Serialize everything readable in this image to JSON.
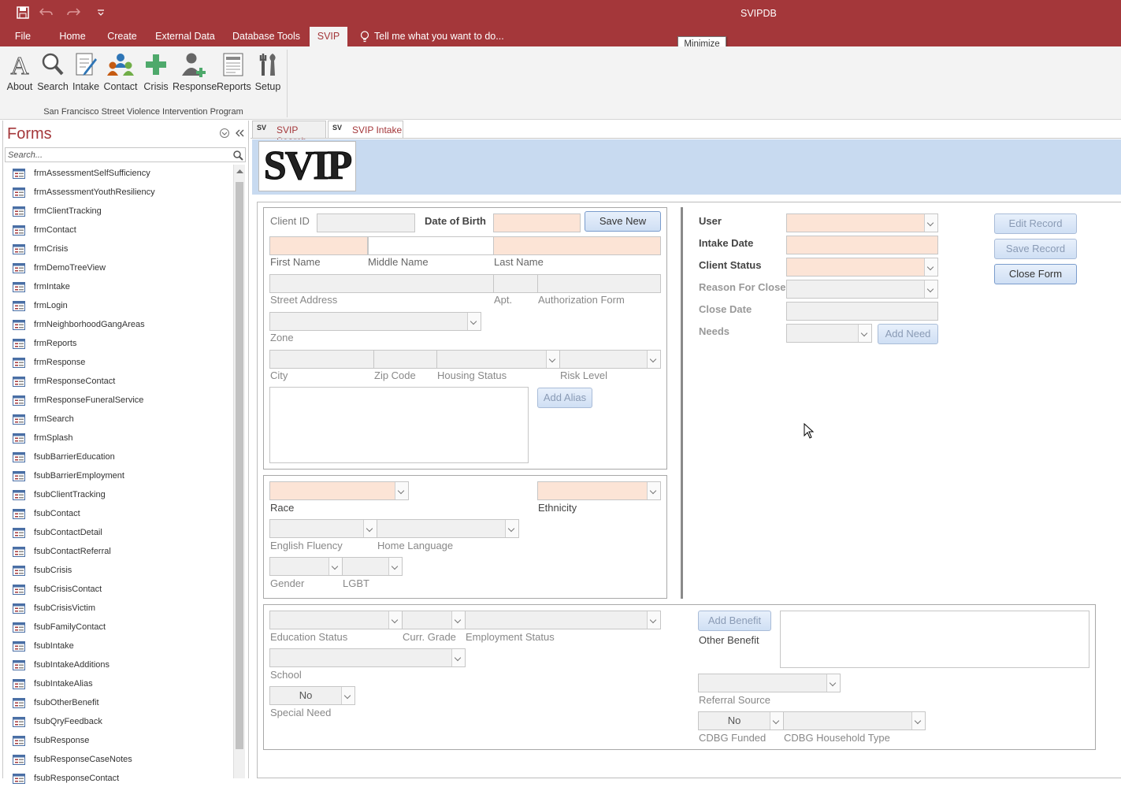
{
  "window": {
    "title": "SVIPDB",
    "tooltip": "Minimize"
  },
  "ribbon_tabs": [
    {
      "label": "File"
    },
    {
      "label": "Home"
    },
    {
      "label": "Create"
    },
    {
      "label": "External Data"
    },
    {
      "label": "Database Tools"
    },
    {
      "label": "SVIP"
    }
  ],
  "tell_me": "Tell me what you want to do...",
  "ribbon_buttons": [
    {
      "label": "About"
    },
    {
      "label": "Search"
    },
    {
      "label": "Intake"
    },
    {
      "label": "Contact"
    },
    {
      "label": "Crisis"
    },
    {
      "label": "Response"
    },
    {
      "label": "Reports"
    },
    {
      "label": "Setup"
    }
  ],
  "ribbon_group": "San Francisco Street Violence Intervention Program",
  "navpane": {
    "title": "Forms",
    "search_placeholder": "Search...",
    "items": [
      "frmAssessmentSelfSufficiency",
      "frmAssessmentYouthResiliency",
      "frmClientTracking",
      "frmContact",
      "frmCrisis",
      "frmDemoTreeView",
      "frmIntake",
      "frmLogin",
      "frmNeighborhoodGangAreas",
      "frmReports",
      "frmResponse",
      "frmResponseContact",
      "frmResponseFuneralService",
      "frmSearch",
      "frmSplash",
      "fsubBarrierEducation",
      "fsubBarrierEmployment",
      "fsubClientTracking",
      "fsubContact",
      "fsubContactDetail",
      "fsubContactReferral",
      "fsubCrisis",
      "fsubCrisisContact",
      "fsubCrisisVictim",
      "fsubFamilyContact",
      "fsubIntake",
      "fsubIntakeAdditions",
      "fsubIntakeAlias",
      "fsubOtherBenefit",
      "fsubQryFeedback",
      "fsubResponse",
      "fsubResponseCaseNotes",
      "fsubResponseContact"
    ]
  },
  "doc_tabs": [
    {
      "label": "SVIP Search"
    },
    {
      "label": "SVIP Intake"
    }
  ],
  "tab_icon_text": "SV",
  "logo": {
    "text": "SVIP"
  },
  "form": {
    "client_id": "Client ID",
    "dob": "Date of Birth",
    "save_new": "Save New",
    "first_name": "First Name",
    "middle_name": "Middle Name",
    "last_name": "Last Name",
    "street": "Street Address",
    "apt": "Apt.",
    "auth": "Authorization Form",
    "zone": "Zone",
    "city": "City",
    "zip": "Zip Code",
    "housing": "Housing Status",
    "risk": "Risk Level",
    "add_alias": "Add Alias",
    "race": "Race",
    "ethnicity": "Ethnicity",
    "english": "English Fluency",
    "home_lang": "Home Language",
    "gender": "Gender",
    "lgbt": "LGBT",
    "user": "User",
    "intake_date": "Intake Date",
    "client_status": "Client Status",
    "reason_close": "Reason For Close",
    "close_date": "Close Date",
    "needs": "Needs",
    "add_need": "Add Need",
    "edit_record": "Edit Record",
    "save_record": "Save Record",
    "close_form": "Close Form",
    "education": "Education Status",
    "grade": "Curr. Grade",
    "employment": "Employment Status",
    "school": "School",
    "special_need_value": "No",
    "special_need": "Special Need",
    "add_benefit": "Add Benefit",
    "other_benefit": "Other Benefit",
    "referral": "Referral Source",
    "cdbg_value": "No",
    "cdbg_funded": "CDBG Funded",
    "cdbg_household": "CDBG Household Type"
  }
}
